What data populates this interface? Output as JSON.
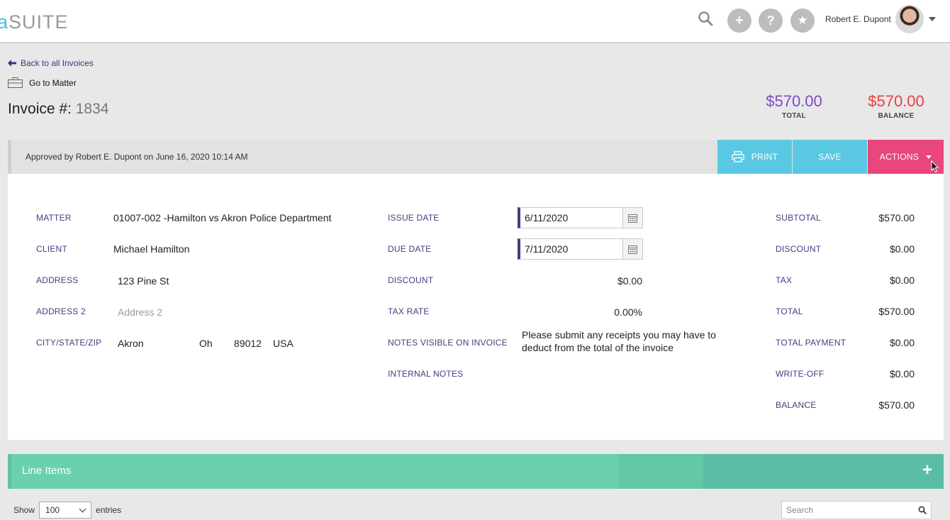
{
  "header": {
    "logo_prefix": "a",
    "logo_text": "SUITE",
    "user_name": "Robert E. Dupont",
    "add_label": "+",
    "help_label": "?",
    "fav_label": "★"
  },
  "nav": {
    "back_label": "Back to all Invoices",
    "matter_label": "Go to Matter"
  },
  "invoice": {
    "title_label": "Invoice #:",
    "number": "1834",
    "total_value": "$570.00",
    "total_label": "TOTAL",
    "balance_value": "$570.00",
    "balance_label": "BALANCE"
  },
  "approval": {
    "text": "Approved by Robert E. Dupont on June 16, 2020 10:14 AM",
    "print_label": "PRINT",
    "save_label": "SAVE",
    "actions_label": "ACTIONS"
  },
  "details": {
    "matter_label": "MATTER",
    "matter_value": "01007-002 -Hamilton vs Akron Police Department",
    "client_label": "CLIENT",
    "client_value": "Michael Hamilton",
    "address_label": "ADDRESS",
    "address_value": "123 Pine St",
    "address2_label": "ADDRESS 2",
    "address2_placeholder": "Address 2",
    "csz_label": "CITY/STATE/ZIP",
    "city": "Akron",
    "state": "Oh",
    "zip": "89012",
    "country": "USA",
    "issue_date_label": "ISSUE DATE",
    "issue_date": "6/11/2020",
    "due_date_label": "DUE DATE",
    "due_date": "7/11/2020",
    "discount_label": "DISCOUNT",
    "discount_value": "$0.00",
    "tax_rate_label": "TAX RATE",
    "tax_rate_value": "0.00%",
    "notes_label": "NOTES VISIBLE ON INVOICE",
    "notes_value": "Please submit any receipts you may have to deduct from the total of the invoice",
    "internal_notes_label": "INTERNAL NOTES"
  },
  "summary": [
    {
      "label": "SUBTOTAL",
      "value": "$570.00"
    },
    {
      "label": "DISCOUNT",
      "value": "$0.00"
    },
    {
      "label": "TAX",
      "value": "$0.00"
    },
    {
      "label": "TOTAL",
      "value": "$570.00"
    },
    {
      "label": "TOTAL PAYMENT",
      "value": "$0.00"
    },
    {
      "label": "WRITE-OFF",
      "value": "$0.00"
    },
    {
      "label": "BALANCE",
      "value": "$570.00"
    }
  ],
  "line_items": {
    "title": "Line Items",
    "add_label": "+",
    "show_label": "Show",
    "page_size": "100",
    "entries_label": "entries",
    "search_placeholder": "Search"
  },
  "colors": {
    "total": "#7b4bc4",
    "balance": "#e8413f",
    "print_save": "#5ac8e3",
    "actions": "#e8467c",
    "line_items": "#6ad1ac"
  }
}
